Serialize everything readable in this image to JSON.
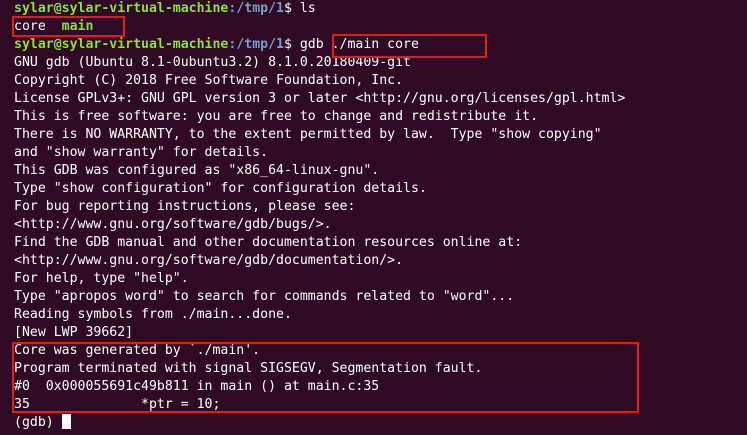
{
  "terminal": {
    "lines": [
      {
        "type": "prompt",
        "user": "sylar@sylar-virtual-machine",
        "path": ":/tmp/1",
        "sym": "$ ",
        "cmd": "ls"
      },
      {
        "type": "ls",
        "a": "core",
        "sep": "  ",
        "b": "main"
      },
      {
        "type": "prompt",
        "user": "sylar@sylar-virtual-machine",
        "path": ":/tmp/1",
        "sym": "$ ",
        "cmd": "gdb ./main core"
      },
      {
        "type": "text",
        "text": "GNU gdb (Ubuntu 8.1-0ubuntu3.2) 8.1.0.20180409-git"
      },
      {
        "type": "text",
        "text": "Copyright (C) 2018 Free Software Foundation, Inc."
      },
      {
        "type": "text",
        "text": "License GPLv3+: GNU GPL version 3 or later <http://gnu.org/licenses/gpl.html>"
      },
      {
        "type": "text",
        "text": "This is free software: you are free to change and redistribute it."
      },
      {
        "type": "text",
        "text": "There is NO WARRANTY, to the extent permitted by law.  Type \"show copying\""
      },
      {
        "type": "text",
        "text": "and \"show warranty\" for details."
      },
      {
        "type": "text",
        "text": "This GDB was configured as \"x86_64-linux-gnu\"."
      },
      {
        "type": "text",
        "text": "Type \"show configuration\" for configuration details."
      },
      {
        "type": "text",
        "text": "For bug reporting instructions, please see:"
      },
      {
        "type": "text",
        "text": "<http://www.gnu.org/software/gdb/bugs/>."
      },
      {
        "type": "text",
        "text": "Find the GDB manual and other documentation resources online at:"
      },
      {
        "type": "text",
        "text": "<http://www.gnu.org/software/gdb/documentation/>."
      },
      {
        "type": "text",
        "text": "For help, type \"help\"."
      },
      {
        "type": "text",
        "text": "Type \"apropos word\" to search for commands related to \"word\"..."
      },
      {
        "type": "text",
        "text": "Reading symbols from ./main...done."
      },
      {
        "type": "text",
        "text": "[New LWP 39662]"
      },
      {
        "type": "text",
        "text": "Core was generated by `./main'."
      },
      {
        "type": "text",
        "text": "Program terminated with signal SIGSEGV, Segmentation fault."
      },
      {
        "type": "text",
        "text": "#0  0x000055691c49b811 in main () at main.c:35"
      },
      {
        "type": "text",
        "text": "35              *ptr = 10;"
      },
      {
        "type": "gdb",
        "text": "(gdb) "
      }
    ]
  },
  "colors": {
    "background": "#300a24",
    "prompt_user": "#8ae234",
    "prompt_path": "#729fcf",
    "executable": "#8ae234",
    "highlight_box": "#e51b1b"
  }
}
